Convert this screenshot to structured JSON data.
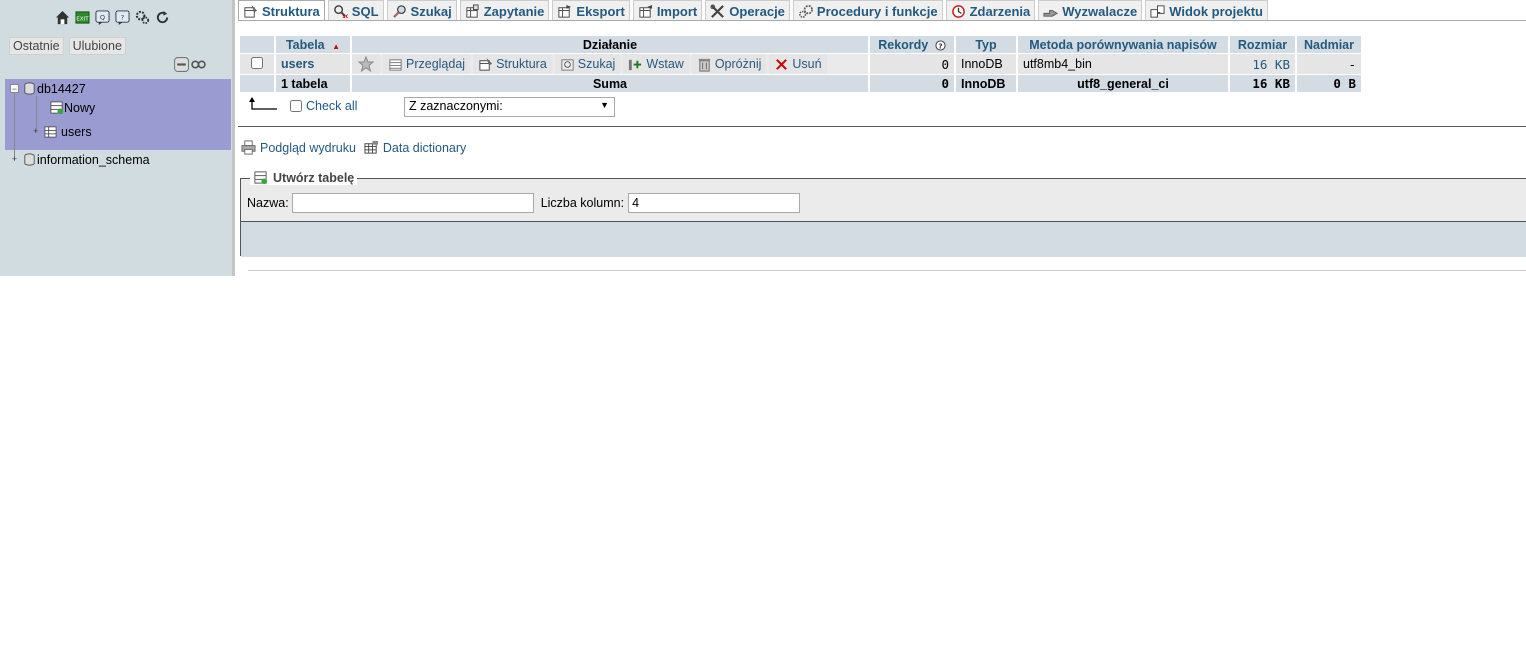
{
  "nav": {
    "recent_label": "Ostatnie",
    "favorites_label": "Ulubione",
    "databases": [
      {
        "name": "db14427",
        "children": [
          {
            "name": "Nowy"
          },
          {
            "name": "users"
          }
        ]
      },
      {
        "name": "information_schema"
      }
    ]
  },
  "tabs": [
    {
      "label": "Struktura",
      "icon": "structure-icon",
      "active": true
    },
    {
      "label": "SQL",
      "icon": "sql-icon"
    },
    {
      "label": "Szukaj",
      "icon": "search-icon"
    },
    {
      "label": "Zapytanie",
      "icon": "query-icon"
    },
    {
      "label": "Eksport",
      "icon": "export-icon"
    },
    {
      "label": "Import",
      "icon": "import-icon"
    },
    {
      "label": "Operacje",
      "icon": "operations-icon"
    },
    {
      "label": "Procedury i funkcje",
      "icon": "routines-icon"
    },
    {
      "label": "Zdarzenia",
      "icon": "events-icon"
    },
    {
      "label": "Wyzwalacze",
      "icon": "triggers-icon"
    },
    {
      "label": "Widok projektu",
      "icon": "designer-icon"
    }
  ],
  "table": {
    "headers": {
      "table": "Tabela",
      "action": "Działanie",
      "rows": "Rekordy",
      "type": "Typ",
      "collation": "Metoda porównywania napisów",
      "size": "Rozmiar",
      "overhead": "Nadmiar"
    },
    "rows": [
      {
        "name": "users",
        "actions": {
          "browse": "Przeglądaj",
          "structure": "Struktura",
          "search": "Szukaj",
          "insert": "Wstaw",
          "empty": "Opróżnij",
          "drop": "Usuń"
        },
        "records": "0",
        "type": "InnoDB",
        "collation": "utf8mb4_bin",
        "size": "16 KB",
        "overhead": "-"
      }
    ],
    "footer": {
      "count": "1 tabela",
      "sum": "Suma",
      "records": "0",
      "type": "InnoDB",
      "collation": "utf8_general_ci",
      "size": "16 KB",
      "overhead": "0 B"
    }
  },
  "bulk": {
    "check_all": "Check all",
    "with_selected": "Z zaznaczonymi:"
  },
  "links": {
    "print_view": "Podgląd wydruku",
    "data_dictionary": "Data dictionary"
  },
  "create": {
    "legend": "Utwórz tabelę",
    "name_label": "Nazwa:",
    "name_value": "",
    "columns_label": "Liczba kolumn:",
    "columns_value": "4"
  },
  "colors": {
    "nav_bg": "#d0dce0",
    "selected_db_bg": "#9a9bd0",
    "header_bg": "#d3dce3",
    "link": "#235a81"
  }
}
